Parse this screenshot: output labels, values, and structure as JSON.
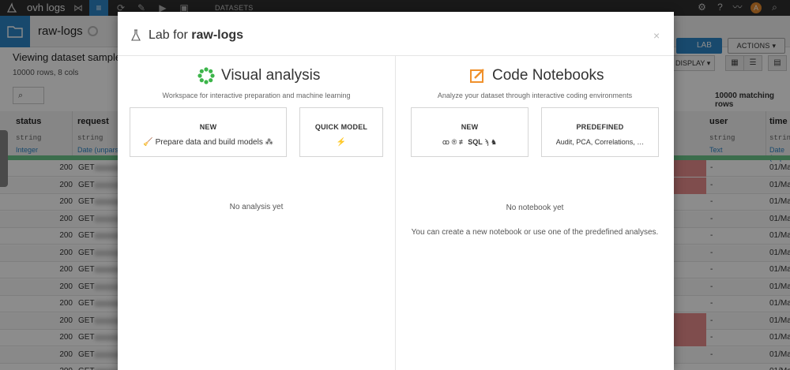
{
  "topnav": {
    "project": "ovh logs",
    "section": "DATASETS",
    "avatar_letter": "A"
  },
  "dataset_header": {
    "name": "raw-logs",
    "lab_label": "LAB",
    "actions_label": "ACTIONS"
  },
  "explore": {
    "title": "Viewing dataset sample",
    "rows_label": "10000 rows,  8 cols",
    "display_label": "DISPLAY",
    "matching": "10000 matching rows"
  },
  "table": {
    "columns": [
      {
        "name": "status",
        "type": "string",
        "meaning": "Integer"
      },
      {
        "name": "request",
        "type": "string",
        "meaning": "Date (unparsed)"
      },
      {
        "name": "user",
        "type": "string",
        "meaning": "Text"
      },
      {
        "name": "time",
        "type": "string",
        "meaning": "Date (unpa"
      }
    ],
    "rows": [
      {
        "status": "200",
        "method": "GET",
        "user": "-",
        "time": "01/Ma",
        "red": true
      },
      {
        "status": "200",
        "method": "GET",
        "user": "-",
        "time": "01/Ma",
        "red": true
      },
      {
        "status": "200",
        "method": "GET",
        "user": "-",
        "time": "01/Ma",
        "red": false
      },
      {
        "status": "200",
        "method": "GET",
        "user": "-",
        "time": "01/Ma",
        "red": false
      },
      {
        "status": "200",
        "method": "GET",
        "user": "-",
        "time": "01/Ma",
        "red": false
      },
      {
        "status": "200",
        "method": "GET",
        "user": "-",
        "time": "01/Ma",
        "red": false
      },
      {
        "status": "200",
        "method": "GET",
        "user": "-",
        "time": "01/Ma",
        "red": false
      },
      {
        "status": "200",
        "method": "GET",
        "user": "-",
        "time": "01/Ma",
        "red": false
      },
      {
        "status": "200",
        "method": "GET",
        "user": "-",
        "time": "01/Ma",
        "red": false
      },
      {
        "status": "200",
        "method": "GET",
        "user": "-",
        "time": "01/Ma",
        "red": true
      },
      {
        "status": "200",
        "method": "GET",
        "user": "-",
        "time": "01/Ma",
        "red": true
      },
      {
        "status": "200",
        "method": "GET",
        "user": "-",
        "time": "01/Ma",
        "red": false
      },
      {
        "status": "200",
        "method": "GET",
        "user": "-",
        "time": "01/Ma",
        "red": false
      }
    ]
  },
  "modal": {
    "title_prefix": "Lab for ",
    "title_dataset": "raw-logs",
    "close": "×",
    "visual": {
      "title": "Visual analysis",
      "subtitle": "Workspace for interactive preparation and machine learning",
      "new_title": "NEW",
      "new_desc": "Prepare data and build models",
      "quick_title": "QUICK MODEL",
      "empty": "No analysis yet"
    },
    "code": {
      "title": "Code Notebooks",
      "subtitle": "Analyze your dataset through interactive coding environments",
      "new_title": "NEW",
      "sql_label": "SQL",
      "predefined_title": "PREDEFINED",
      "predefined_desc": "Audit, PCA, Correlations, …",
      "empty": "No notebook yet",
      "hint": "You can create a new notebook or use one of the predefined analyses."
    }
  },
  "colors": {
    "accent": "#2d85c6",
    "visual_green": "#3cb54a",
    "code_orange": "#f0912c"
  }
}
